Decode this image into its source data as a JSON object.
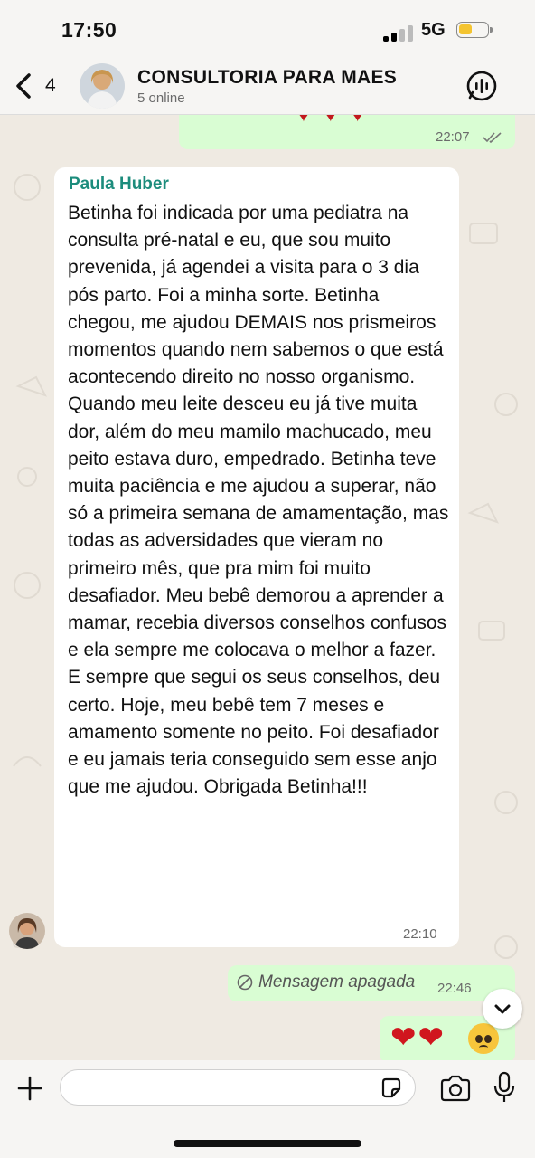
{
  "status_bar": {
    "time": "17:50",
    "network": "5G"
  },
  "header": {
    "back_count": "4",
    "title": "CONSULTORIA PARA MAES",
    "subtitle": "5 online"
  },
  "messages": {
    "top_outgoing": {
      "time": "22:07"
    },
    "incoming": {
      "sender": "Paula Huber",
      "text": "Betinha foi indicada por uma pediatra na consulta pré-natal e eu, que sou muito prevenida, já agendei a visita para o 3 dia pós parto. Foi a minha sorte. Betinha chegou, me ajudou DEMAIS nos prismeiros momentos quando nem sabemos o que está acontecendo direito no nosso organismo. Quando meu leite desceu eu já tive muita dor, além do meu mamilo machucado, meu peito estava duro, empedrado. Betinha teve muita paciência e me ajudou a superar, não só a primeira semana de amamentação, mas todas as adversidades que vieram no primeiro mês, que pra mim foi muito desafiador. Meu bebê demorou a aprender a mamar, recebia diversos conselhos confusos e ela sempre me colocava o melhor a fazer. E sempre que segui os seus conselhos, deu certo. Hoje, meu bebê tem 7 meses e amamento somente no peito. Foi desafiador e eu jamais teria conseguido sem esse anjo que me ajudou. Obrigada Betinha!!!",
      "time": "22:10"
    },
    "deleted": {
      "text": "Mensagem apagada",
      "time": "22:46"
    },
    "reaction": {
      "hearts": "❤❤"
    }
  },
  "colors": {
    "outgoing_bubble": "#d9fdd3",
    "incoming_bubble": "#ffffff",
    "sender_name": "#1c8c7c",
    "background": "#efeae2"
  },
  "icons": [
    "back-chevron-icon",
    "audio-call-icon",
    "read-ticks-icon",
    "blocked-icon",
    "chevron-down-icon",
    "plus-icon",
    "sticker-icon",
    "camera-icon",
    "microphone-icon"
  ]
}
